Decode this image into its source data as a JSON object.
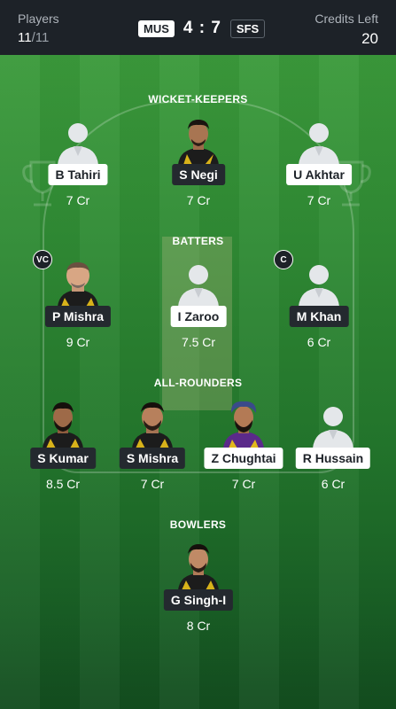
{
  "header": {
    "players_label": "Players",
    "players_selected": "11",
    "players_total": "/11",
    "team1": "MUS",
    "score": "4 : 7",
    "team2": "SFS",
    "credits_label": "Credits Left",
    "credits_value": "20"
  },
  "sections": {
    "wicket_keepers": "WICKET-KEEPERS",
    "batters": "BATTERS",
    "all_rounders": "ALL-ROUNDERS",
    "bowlers": "BOWLERS"
  },
  "players": {
    "wk": [
      {
        "name": "B Tahiri",
        "credit": "7 Cr",
        "team": "SFS",
        "photo": "placeholder"
      },
      {
        "name": "S Negi",
        "credit": "7 Cr",
        "team": "MUS",
        "photo": "real"
      },
      {
        "name": "U Akhtar",
        "credit": "7 Cr",
        "team": "SFS",
        "photo": "placeholder"
      }
    ],
    "bat": [
      {
        "name": "P Mishra",
        "credit": "9 Cr",
        "team": "MUS",
        "photo": "real",
        "badge": "VC"
      },
      {
        "name": "I Zaroo",
        "credit": "7.5 Cr",
        "team": "SFS",
        "photo": "placeholder"
      },
      {
        "name": "M Khan",
        "credit": "6 Cr",
        "team": "MUS",
        "photo": "placeholder",
        "badge": "C"
      }
    ],
    "ar": [
      {
        "name": "S Kumar",
        "credit": "8.5 Cr",
        "team": "MUS",
        "photo": "real"
      },
      {
        "name": "S Mishra",
        "credit": "7 Cr",
        "team": "MUS",
        "photo": "real"
      },
      {
        "name": "Z Chughtai",
        "credit": "7 Cr",
        "team": "SFS",
        "photo": "real"
      },
      {
        "name": "R Hussain",
        "credit": "6 Cr",
        "team": "SFS",
        "photo": "placeholder"
      }
    ],
    "bowl": [
      {
        "name": "G Singh-I",
        "credit": "8 Cr",
        "team": "MUS",
        "photo": "real"
      }
    ]
  },
  "colors": {
    "header_bg": "#1d2228",
    "field_green": "#2f8a34",
    "tag_dark": "#24292f",
    "tag_light": "#ffffff"
  }
}
